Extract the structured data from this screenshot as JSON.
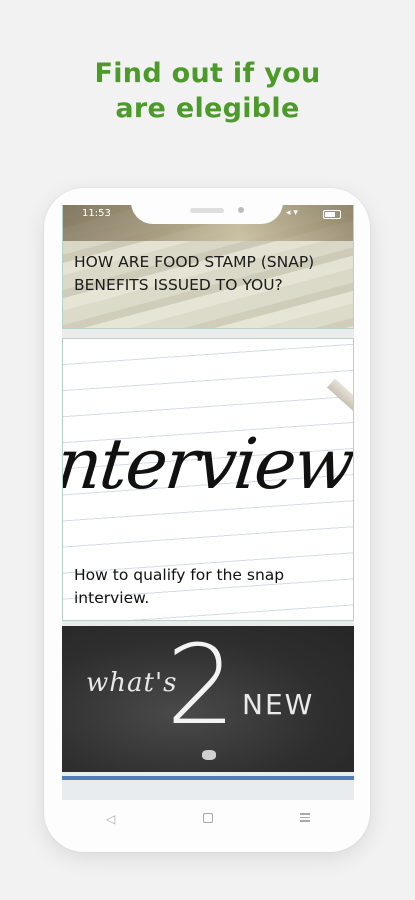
{
  "headline": {
    "line1": "Find out if you",
    "line2": "are elegible"
  },
  "status_bar": {
    "time": "11:53",
    "signal": "◂ ▾",
    "battery": "battery-icon"
  },
  "cards": [
    {
      "title": "HOW ARE FOOD STAMP (SNAP) BENEFITS ISSUED TO YOU?",
      "image": "dollar-bills-image"
    },
    {
      "title": "How to qualify for the snap interview.",
      "image": "interview-handwriting-image",
      "script": "nterview"
    },
    {
      "image": "chalkboard-whats-new-image",
      "chalk_left": "what's",
      "chalk_number": "2",
      "chalk_right": "NEW"
    }
  ],
  "nav": {
    "back": "◁",
    "home": "home-square-icon",
    "recents": "menu-lines-icon"
  },
  "colors": {
    "headline": "#4c9a2a",
    "card_border": "#b8d1c7",
    "partial_card_edge": "#4f7fb7"
  }
}
